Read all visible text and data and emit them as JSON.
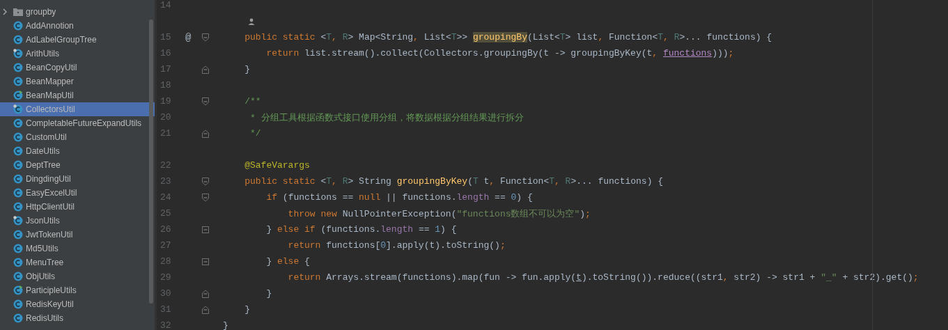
{
  "sidebar": {
    "items": [
      {
        "name": "groupby",
        "kind": "folder",
        "expanded": false,
        "selected": false
      },
      {
        "name": "AddAnnotion",
        "kind": "class",
        "selected": false
      },
      {
        "name": "AdLabelGroupTree",
        "kind": "class",
        "selected": false
      },
      {
        "name": "ArithUtils",
        "kind": "class_pin",
        "selected": false
      },
      {
        "name": "BeanCopyUtil",
        "kind": "class",
        "selected": false
      },
      {
        "name": "BeanMapper",
        "kind": "class",
        "selected": false
      },
      {
        "name": "BeanMapUtil",
        "kind": "class_run",
        "selected": false
      },
      {
        "name": "CollectorsUtil",
        "kind": "class_pin",
        "selected": true
      },
      {
        "name": "CompletableFutureExpandUtils",
        "kind": "class",
        "selected": false
      },
      {
        "name": "CustomUtil",
        "kind": "class",
        "selected": false
      },
      {
        "name": "DateUtils",
        "kind": "class",
        "selected": false
      },
      {
        "name": "DeptTree",
        "kind": "class",
        "selected": false
      },
      {
        "name": "DingdingUtil",
        "kind": "class",
        "selected": false
      },
      {
        "name": "EasyExcelUtil",
        "kind": "class",
        "selected": false
      },
      {
        "name": "HttpClientUtil",
        "kind": "class",
        "selected": false
      },
      {
        "name": "JsonUtils",
        "kind": "class_pin",
        "selected": false
      },
      {
        "name": "JwtTokenUtil",
        "kind": "class",
        "selected": false
      },
      {
        "name": "Md5Utils",
        "kind": "class",
        "selected": false
      },
      {
        "name": "MenuTree",
        "kind": "class",
        "selected": false
      },
      {
        "name": "ObjUtils",
        "kind": "class",
        "selected": false
      },
      {
        "name": "ParticipleUtils",
        "kind": "class_run",
        "selected": false
      },
      {
        "name": "RedisKeyUtil",
        "kind": "class",
        "selected": false
      },
      {
        "name": "RedisUtils",
        "kind": "class",
        "selected": false
      }
    ]
  },
  "editor": {
    "lines": [
      {
        "kind": "code",
        "number": "14",
        "fold_start": false,
        "fold_end": false
      },
      {
        "kind": "hint_person"
      },
      {
        "kind": "code",
        "number": "15",
        "marker": "@",
        "fold_start": true,
        "fold_end": false,
        "tokens": [
          {
            "text": "    public static ",
            "kind": "kw"
          },
          {
            "text": "<",
            "kind": "plain"
          },
          {
            "text": "T",
            "kind": "tparam"
          },
          {
            "text": ", ",
            "kind": "kw"
          },
          {
            "text": "R",
            "kind": "tparam"
          },
          {
            "text": "> Map<String",
            "kind": "plain"
          },
          {
            "text": ", ",
            "kind": "kw"
          },
          {
            "text": "List<",
            "kind": "plain"
          },
          {
            "text": "T",
            "kind": "tparam"
          },
          {
            "text": ">> ",
            "kind": "plain"
          },
          {
            "text": "groupingBy",
            "kind": "decl_hl"
          },
          {
            "text": "(List<",
            "kind": "plain"
          },
          {
            "text": "T",
            "kind": "tparam"
          },
          {
            "text": "> list",
            "kind": "plain"
          },
          {
            "text": ", ",
            "kind": "kw"
          },
          {
            "text": "Function<",
            "kind": "plain"
          },
          {
            "text": "T",
            "kind": "tparam"
          },
          {
            "text": ", ",
            "kind": "kw"
          },
          {
            "text": "R",
            "kind": "tparam"
          },
          {
            "text": ">... functions) {",
            "kind": "plain"
          }
        ]
      },
      {
        "kind": "code",
        "number": "16",
        "fold_start": false,
        "fold_end": false,
        "tokens": [
          {
            "text": "        return ",
            "kind": "kw"
          },
          {
            "text": "list.stream().collect(Collectors.groupingBy(t -> groupingByKey(t",
            "kind": "plain"
          },
          {
            "text": ", ",
            "kind": "kw"
          },
          {
            "text": "functions",
            "kind": "param_ul"
          },
          {
            "text": ")))",
            "kind": "plain"
          },
          {
            "text": ";",
            "kind": "kw"
          }
        ]
      },
      {
        "kind": "code",
        "number": "17",
        "fold_start": false,
        "fold_end": true,
        "tokens": [
          {
            "text": "    }",
            "kind": "plain"
          }
        ]
      },
      {
        "kind": "code",
        "number": "18",
        "fold_start": false,
        "fold_end": false
      },
      {
        "kind": "code",
        "number": "19",
        "fold_start": true,
        "fold_end": false,
        "tokens": [
          {
            "text": "    /**",
            "kind": "comment"
          }
        ]
      },
      {
        "kind": "code",
        "number": "20",
        "fold_start": false,
        "fold_end": false,
        "tokens": [
          {
            "text": "     * 分组工具根据函数式接口使用分组，将数据根据分组结果进行拆分",
            "kind": "comment"
          }
        ]
      },
      {
        "kind": "code",
        "number": "21",
        "fold_start": false,
        "fold_end": true,
        "tokens": [
          {
            "text": "     */",
            "kind": "comment"
          }
        ]
      },
      {
        "kind": "hint"
      },
      {
        "kind": "code",
        "number": "22",
        "fold_start": false,
        "fold_end": false,
        "tokens": [
          {
            "text": "    @SafeVarargs",
            "kind": "annotation"
          }
        ]
      },
      {
        "kind": "code",
        "number": "23",
        "fold_start": true,
        "fold_end": false,
        "tokens": [
          {
            "text": "    public static ",
            "kind": "kw"
          },
          {
            "text": "<",
            "kind": "plain"
          },
          {
            "text": "T",
            "kind": "tparam"
          },
          {
            "text": ", ",
            "kind": "kw"
          },
          {
            "text": "R",
            "kind": "tparam"
          },
          {
            "text": "> String ",
            "kind": "plain"
          },
          {
            "text": "groupingByKey",
            "kind": "decl"
          },
          {
            "text": "(",
            "kind": "plain"
          },
          {
            "text": "T",
            "kind": "tparam"
          },
          {
            "text": " t",
            "kind": "plain"
          },
          {
            "text": ", ",
            "kind": "kw"
          },
          {
            "text": "Function<",
            "kind": "plain"
          },
          {
            "text": "T",
            "kind": "tparam"
          },
          {
            "text": ", ",
            "kind": "kw"
          },
          {
            "text": "R",
            "kind": "tparam"
          },
          {
            "text": ">... functions) {",
            "kind": "plain"
          }
        ]
      },
      {
        "kind": "code",
        "number": "24",
        "fold_start": true,
        "fold_end": false,
        "tokens": [
          {
            "text": "        if ",
            "kind": "kw"
          },
          {
            "text": "(functions == ",
            "kind": "plain"
          },
          {
            "text": "null",
            "kind": "kw"
          },
          {
            "text": " || functions.",
            "kind": "plain"
          },
          {
            "text": "length",
            "kind": "field"
          },
          {
            "text": " == ",
            "kind": "plain"
          },
          {
            "text": "0",
            "kind": "number"
          },
          {
            "text": ") {",
            "kind": "plain"
          }
        ]
      },
      {
        "kind": "code",
        "number": "25",
        "fold_start": false,
        "fold_end": false,
        "tokens": [
          {
            "text": "            throw new ",
            "kind": "kw"
          },
          {
            "text": "NullPointerException(",
            "kind": "plain"
          },
          {
            "text": "\"functions数组不可以为空\"",
            "kind": "string"
          },
          {
            "text": ")",
            "kind": "plain"
          },
          {
            "text": ";",
            "kind": "kw"
          }
        ]
      },
      {
        "kind": "code",
        "number": "26",
        "fold_start": true,
        "fold_end": true,
        "tokens": [
          {
            "text": "        } ",
            "kind": "plain"
          },
          {
            "text": "else if ",
            "kind": "kw"
          },
          {
            "text": "(functions.",
            "kind": "plain"
          },
          {
            "text": "length",
            "kind": "field"
          },
          {
            "text": " == ",
            "kind": "plain"
          },
          {
            "text": "1",
            "kind": "number"
          },
          {
            "text": ") {",
            "kind": "plain"
          }
        ]
      },
      {
        "kind": "code",
        "number": "27",
        "fold_start": false,
        "fold_end": false,
        "tokens": [
          {
            "text": "            return ",
            "kind": "kw"
          },
          {
            "text": "functions[",
            "kind": "plain"
          },
          {
            "text": "0",
            "kind": "number"
          },
          {
            "text": "].apply(t).toString()",
            "kind": "plain"
          },
          {
            "text": ";",
            "kind": "kw"
          }
        ]
      },
      {
        "kind": "code",
        "number": "28",
        "fold_start": true,
        "fold_end": true,
        "tokens": [
          {
            "text": "        } ",
            "kind": "plain"
          },
          {
            "text": "else ",
            "kind": "kw"
          },
          {
            "text": "{",
            "kind": "plain"
          }
        ]
      },
      {
        "kind": "code",
        "number": "29",
        "fold_start": false,
        "fold_end": false,
        "tokens": [
          {
            "text": "            return ",
            "kind": "kw"
          },
          {
            "text": "Arrays.stream(functions).map(fun -> fun.apply(",
            "kind": "plain"
          },
          {
            "text": "t",
            "kind": "plain_ul"
          },
          {
            "text": ").toString()).reduce((str1",
            "kind": "plain"
          },
          {
            "text": ", ",
            "kind": "kw"
          },
          {
            "text": "str2) -> str1 + ",
            "kind": "plain"
          },
          {
            "text": "\"_\"",
            "kind": "string"
          },
          {
            "text": " + str2).get()",
            "kind": "plain"
          },
          {
            "text": ";",
            "kind": "kw"
          }
        ]
      },
      {
        "kind": "code",
        "number": "30",
        "fold_start": false,
        "fold_end": true,
        "tokens": [
          {
            "text": "        }",
            "kind": "plain"
          }
        ]
      },
      {
        "kind": "code",
        "number": "31",
        "fold_start": false,
        "fold_end": true,
        "tokens": [
          {
            "text": "    }",
            "kind": "plain"
          }
        ]
      },
      {
        "kind": "code",
        "number": "32",
        "fold_start": false,
        "fold_end": false,
        "tokens": [
          {
            "text": "}",
            "kind": "plain"
          }
        ]
      }
    ]
  }
}
